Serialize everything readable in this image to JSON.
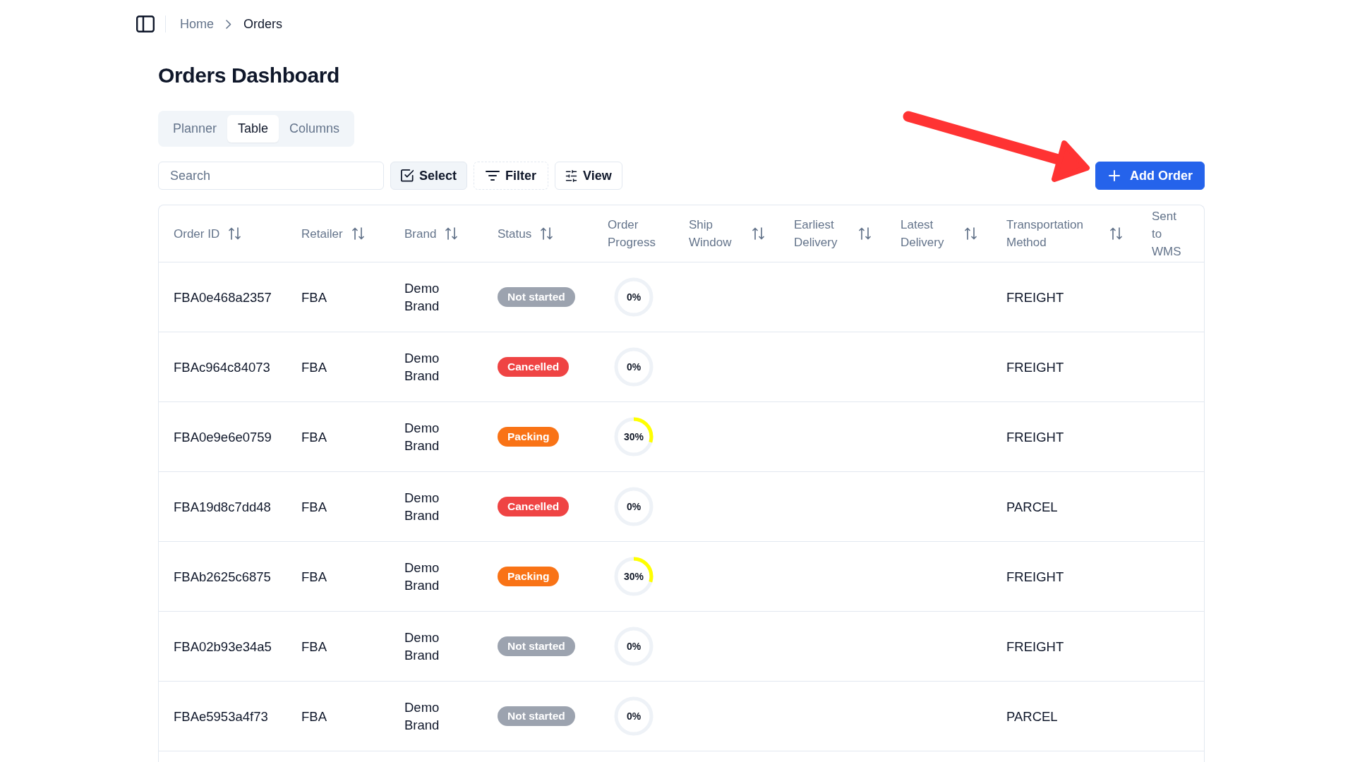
{
  "breadcrumb": {
    "items": [
      {
        "label": "Home",
        "current": false
      },
      {
        "label": "Orders",
        "current": true
      }
    ]
  },
  "page_title": "Orders Dashboard",
  "tabs": [
    {
      "label": "Planner",
      "selected": false
    },
    {
      "label": "Table",
      "selected": true
    },
    {
      "label": "Columns",
      "selected": false
    }
  ],
  "toolbar": {
    "search": {
      "placeholder": "Search"
    },
    "buttons": [
      {
        "label": "Select",
        "kind": "select"
      },
      {
        "label": "Filter",
        "kind": "filter"
      },
      {
        "label": "View",
        "kind": "view"
      }
    ],
    "add_button": {
      "label": "Add Order"
    }
  },
  "annotation": {
    "kind": "arrow"
  },
  "table": {
    "columns": [
      {
        "label": "Order ID",
        "sortable": true
      },
      {
        "label": "Retailer",
        "sortable": true
      },
      {
        "label": "Brand",
        "sortable": true
      },
      {
        "label": "Status",
        "sortable": true
      },
      {
        "label": "Order Progress",
        "sortable": false
      },
      {
        "label": "Ship Window",
        "sortable": true
      },
      {
        "label": "Earliest Delivery",
        "sortable": true
      },
      {
        "label": "Latest Delivery",
        "sortable": true
      },
      {
        "label": "Transportation Method",
        "sortable": true
      },
      {
        "label": "Sent to WMS",
        "sortable": false
      }
    ],
    "rows": [
      {
        "order_id": "FBA0e468a2357",
        "retailer": "FBA",
        "brand": "Demo Brand",
        "status": {
          "label": "Not started",
          "color": "#9ca3af"
        },
        "progress": {
          "label": "0%",
          "level": 0
        },
        "transportation_method": "FREIGHT"
      },
      {
        "order_id": "FBAc964c84073",
        "retailer": "FBA",
        "brand": "Demo Brand",
        "status": {
          "label": "Cancelled",
          "color": "#ef4444"
        },
        "progress": {
          "label": "0%",
          "level": 0
        },
        "transportation_method": "FREIGHT"
      },
      {
        "order_id": "FBA0e9e6e0759",
        "retailer": "FBA",
        "brand": "Demo Brand",
        "status": {
          "label": "Packing",
          "color": "#f97316"
        },
        "progress": {
          "label": "30%",
          "level": 0.3
        },
        "transportation_method": "FREIGHT"
      },
      {
        "order_id": "FBA19d8c7dd48",
        "retailer": "FBA",
        "brand": "Demo Brand",
        "status": {
          "label": "Cancelled",
          "color": "#ef4444"
        },
        "progress": {
          "label": "0%",
          "level": 0
        },
        "transportation_method": "PARCEL"
      },
      {
        "order_id": "FBAb2625c6875",
        "retailer": "FBA",
        "brand": "Demo Brand",
        "status": {
          "label": "Packing",
          "color": "#f97316"
        },
        "progress": {
          "label": "30%",
          "level": 0.3
        },
        "transportation_method": "FREIGHT"
      },
      {
        "order_id": "FBA02b93e34a5",
        "retailer": "FBA",
        "brand": "Demo Brand",
        "status": {
          "label": "Not started",
          "color": "#9ca3af"
        },
        "progress": {
          "label": "0%",
          "level": 0
        },
        "transportation_method": "FREIGHT"
      },
      {
        "order_id": "FBAe5953a4f73",
        "retailer": "FBA",
        "brand": "Demo Brand",
        "status": {
          "label": "Not started",
          "color": "#9ca3af"
        },
        "progress": {
          "label": "0%",
          "level": 0
        },
        "transportation_method": "PARCEL"
      }
    ]
  }
}
